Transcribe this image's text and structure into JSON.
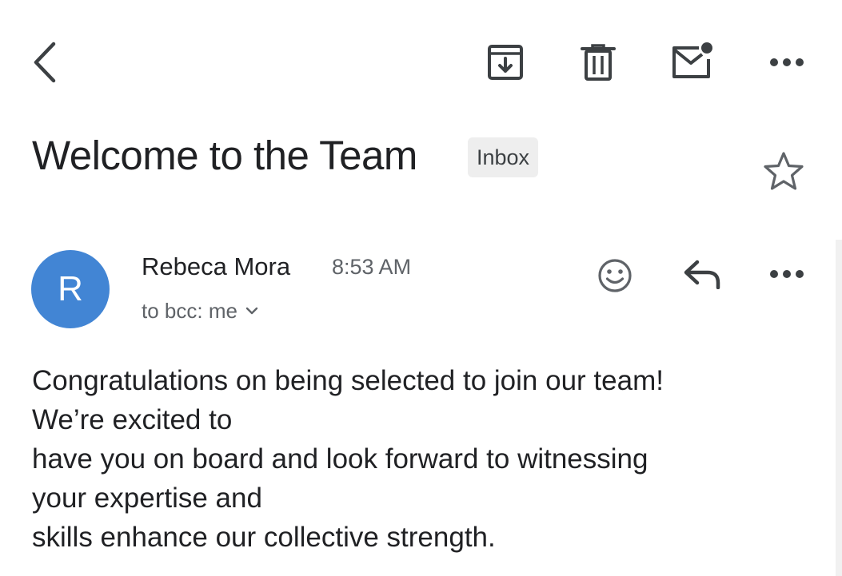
{
  "toolbar": {
    "back_icon": "chevron-left-icon",
    "archive_icon": "archive-icon",
    "delete_icon": "trash-icon",
    "mark_unread_icon": "mark-unread-icon",
    "more_icon": "more-horizontal-icon"
  },
  "email": {
    "subject": "Welcome to the Team",
    "label": "Inbox",
    "sender_initial": "R",
    "sender_name": "Rebeca Mora",
    "time": "8:53 AM",
    "recipient": "to bcc: me",
    "body": "Congratulations on being selected to join our team!\nWe’re excited to\nhave you on board and look forward to witnessing\nyour expertise and\nskills enhance our collective strength."
  },
  "colors": {
    "avatar_bg": "#4285d4",
    "icon": "#3c4043",
    "chip_bg": "#eeeeee"
  }
}
